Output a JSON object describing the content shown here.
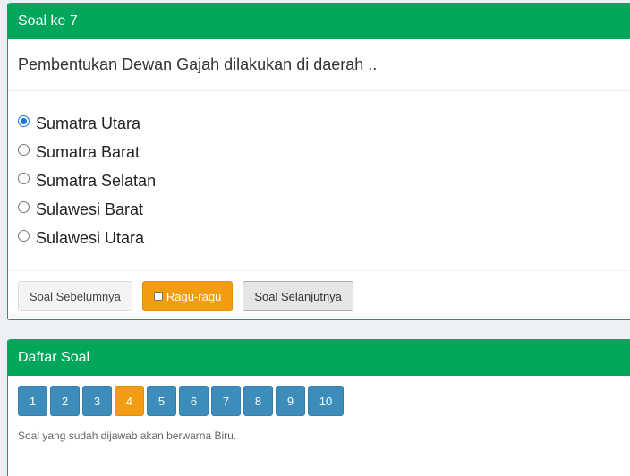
{
  "question_box": {
    "title": "Soal ke 7",
    "question": "Pembentukan Dewan Gajah dilakukan di daerah ..",
    "options": [
      {
        "label": "Sumatra Utara",
        "selected": true
      },
      {
        "label": "Sumatra Barat",
        "selected": false
      },
      {
        "label": "Sumatra Selatan",
        "selected": false
      },
      {
        "label": "Sulawesi Barat",
        "selected": false
      },
      {
        "label": "Sulawesi Utara",
        "selected": false
      }
    ],
    "buttons": {
      "prev": "Soal Sebelumnya",
      "doubt": "Ragu-ragu",
      "next": "Soal Selanjutnya"
    }
  },
  "list_box": {
    "title": "Daftar Soal",
    "numbers": [
      "1",
      "2",
      "3",
      "4",
      "5",
      "6",
      "7",
      "8",
      "9",
      "10"
    ],
    "doubtful_number": "4",
    "note": "Soal yang sudah dijawab akan berwarna Biru."
  },
  "colors": {
    "header_green": "#00a65a",
    "answered_blue": "#3c8dbc",
    "doubt_orange": "#f39c12"
  }
}
